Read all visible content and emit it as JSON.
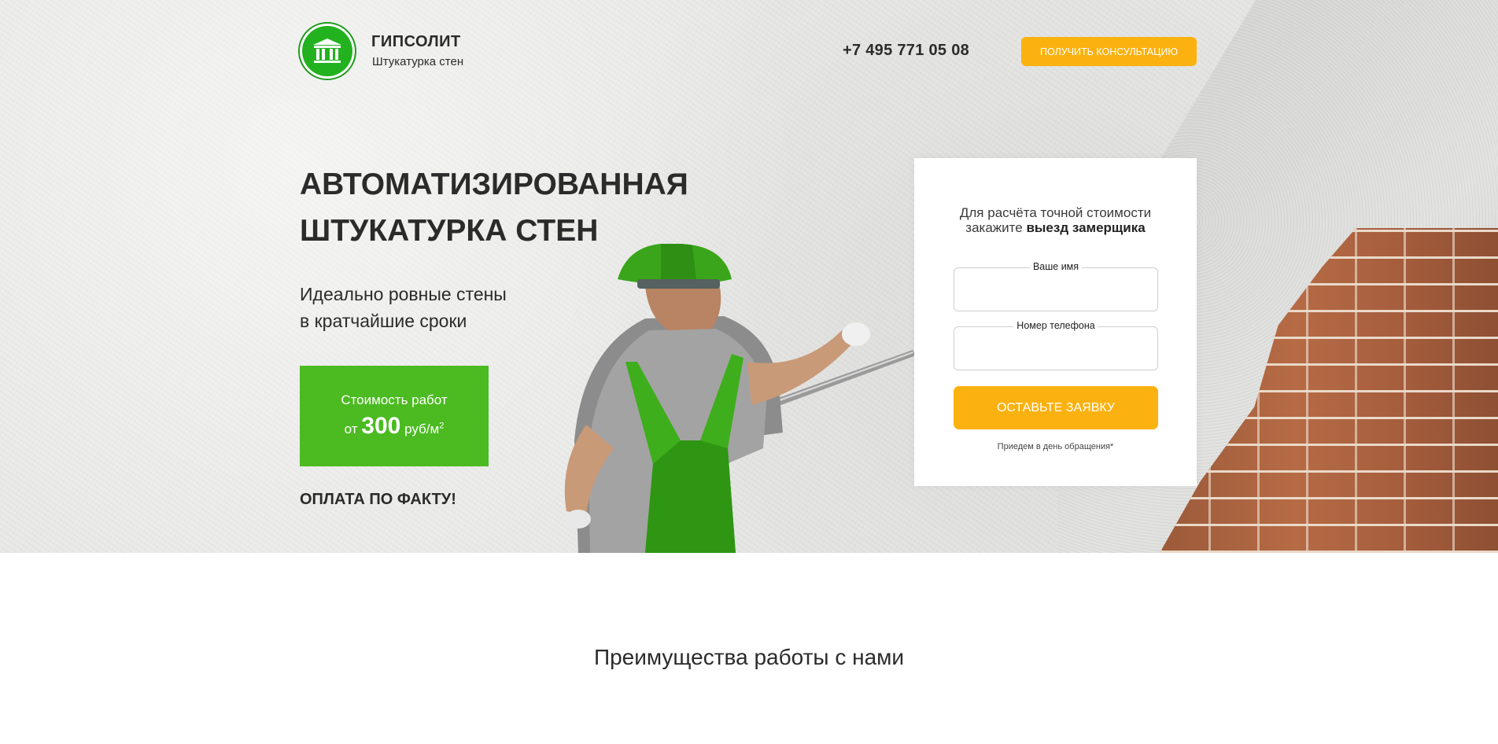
{
  "header": {
    "brand_name": "ГИПСОЛИТ",
    "brand_subtitle": "Штукатурка стен",
    "phone": "+7 495 771 05 08",
    "consult_button": "ПОЛУЧИТЬ КОНСУЛЬТАЦИЮ",
    "logo_icon": "bank-columns-icon"
  },
  "hero": {
    "headline_line1": "АВТОМАТИЗИРОВАННАЯ",
    "headline_line2": "ШТУКАТУРКА СТЕН",
    "subheadline_line1": "Идеально ровные стены",
    "subheadline_line2": "в кратчайшие сроки",
    "price_label": "Стоимость работ",
    "price_prefix": "от",
    "price_value": "300",
    "price_unit": "руб/м",
    "price_unit_sup": "2",
    "payment_note": "ОПЛАТА ПО ФАКТУ!"
  },
  "form": {
    "intro_line1": "Для расчёта точной стоимости",
    "intro_line2_plain": "закажите",
    "intro_line2_bold": "выезд замерщика",
    "name_label": "Ваше имя",
    "name_value": "",
    "phone_label": "Номер телефона",
    "phone_value": "",
    "submit_button": "ОСТАВЬТЕ ЗАЯВКУ",
    "note": "Приедем в день обращения*"
  },
  "advantages": {
    "title": "Преимущества работы с нами"
  },
  "colors": {
    "accent_green": "#4bbb21",
    "logo_green": "#22b21f",
    "accent_orange": "#fbb110",
    "text_dark": "#2b2b2b"
  }
}
